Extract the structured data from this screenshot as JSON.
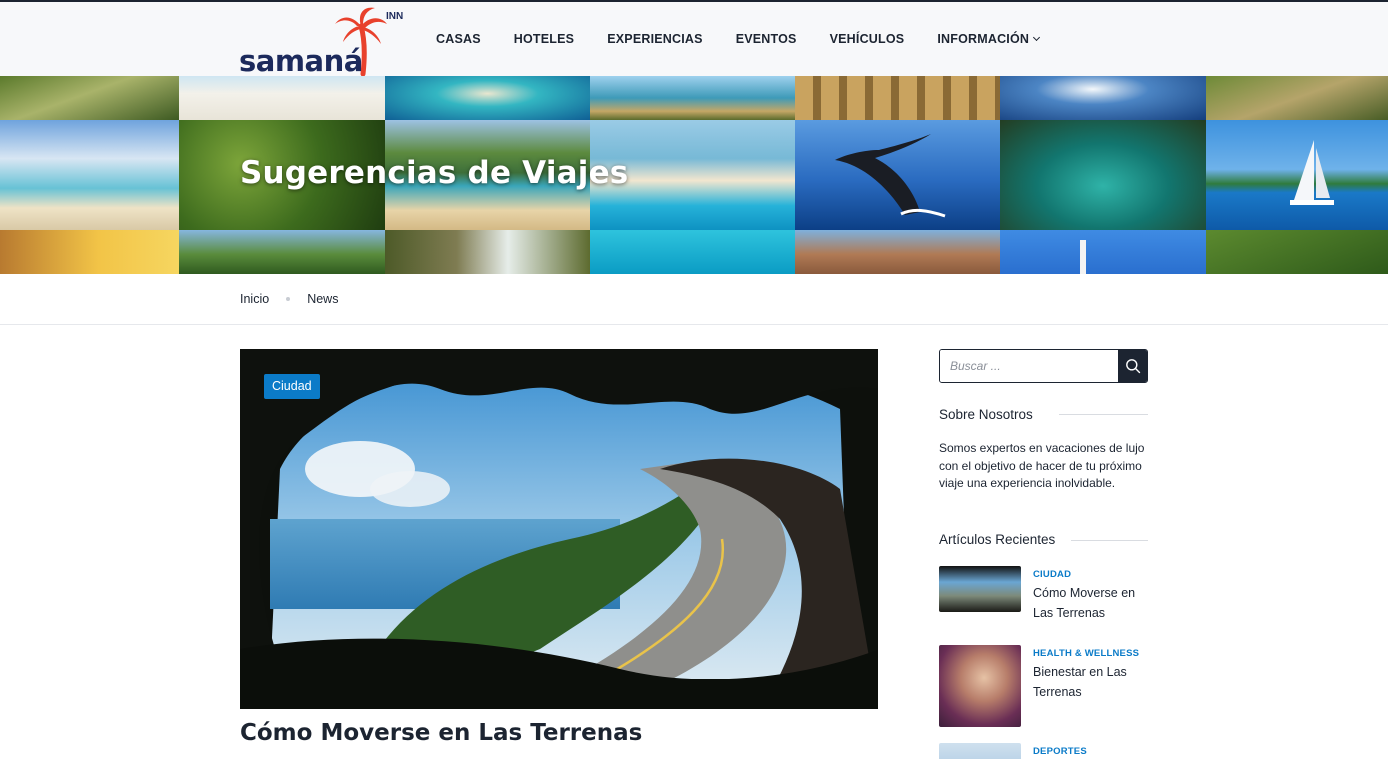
{
  "header": {
    "logo_text": "samaná",
    "logo_suffix": "INN",
    "nav": [
      {
        "label": "CASAS"
      },
      {
        "label": "HOTELES"
      },
      {
        "label": "EXPERIENCIAS"
      },
      {
        "label": "EVENTOS"
      },
      {
        "label": "VEHÍCULOS"
      },
      {
        "label": "INFORMACIÓN",
        "has_dropdown": true
      }
    ]
  },
  "hero": {
    "title": "Sugerencias de Viajes"
  },
  "breadcrumb": {
    "home": "Inicio",
    "current": "News"
  },
  "article": {
    "category": "Ciudad",
    "title": "Cómo Moverse en Las Terrenas"
  },
  "sidebar": {
    "search": {
      "placeholder": "Buscar ...",
      "value": ""
    },
    "about": {
      "title": "Sobre Nosotros",
      "text": "Somos expertos en vacaciones de lujo con el objetivo de hacer de tu próximo viaje una experiencia inolvidable."
    },
    "recent": {
      "title": "Artículos Recientes",
      "items": [
        {
          "category": "CIUDAD",
          "title": "Cómo Moverse en Las Terrenas"
        },
        {
          "category": "HEALTH & WELLNESS",
          "title": "Bienestar en Las Terrenas"
        },
        {
          "category": "DEPORTES",
          "title": ""
        }
      ]
    }
  },
  "colors": {
    "brand_navy": "#1c2a5c",
    "accent_blue": "#0b7bc8",
    "logo_red": "#e8412c",
    "text_dark": "#1c2431"
  }
}
